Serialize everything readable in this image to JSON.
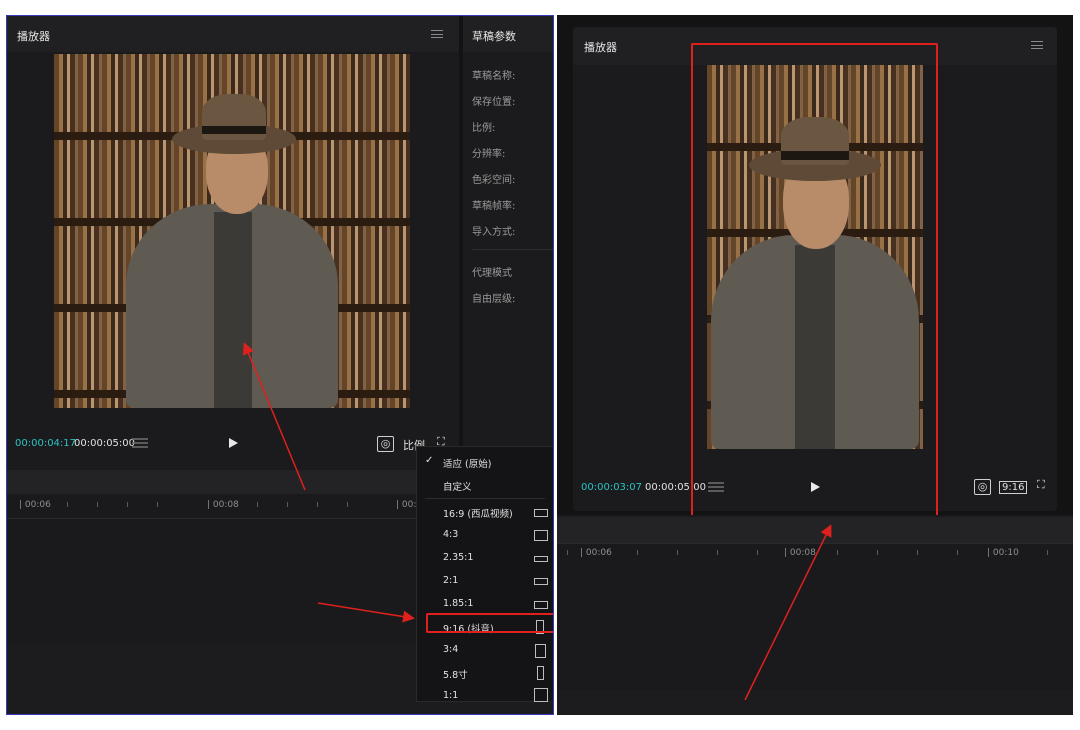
{
  "left": {
    "player": {
      "title": "播放器",
      "current_time": "00:00:04:17",
      "total_time": "00:00:05:00",
      "ratio_button": "比例"
    },
    "draft_params": {
      "title": "草稿参数",
      "fields": [
        "草稿名称:",
        "保存位置:",
        "比例:",
        "分辨率:",
        "色彩空间:",
        "草稿帧率:",
        "导入方式:"
      ],
      "fields2": [
        "代理模式",
        "自由层级:"
      ]
    },
    "timeline": {
      "ticks": [
        "| 00:06",
        "| 00:08",
        "| 00:1"
      ]
    },
    "ratio_menu": {
      "checked": "✓",
      "items": [
        "适应 (原始)",
        "自定义",
        "16:9 (西瓜视频)",
        "4:3",
        "2.35:1",
        "2:1",
        "1.85:1",
        "9:16 (抖音)",
        "3:4",
        "5.8寸",
        "1:1"
      ],
      "selected": "9:16 (抖音)"
    }
  },
  "right": {
    "player": {
      "title": "播放器",
      "current_time": "00:00:03:07",
      "total_time": "00:00:05:00",
      "ratio_badge": "9:16"
    },
    "timeline": {
      "ticks": [
        "| 00:06",
        "| 00:08",
        "| 00:10"
      ]
    }
  },
  "colors": {
    "accent_time": "#27c3c3",
    "highlight": "#e0201c",
    "panel_bg": "#1b1b1d"
  },
  "icons": [
    "menu-icon",
    "play-icon",
    "layers-icon",
    "focus-icon",
    "fullscreen-icon",
    "check-icon"
  ]
}
